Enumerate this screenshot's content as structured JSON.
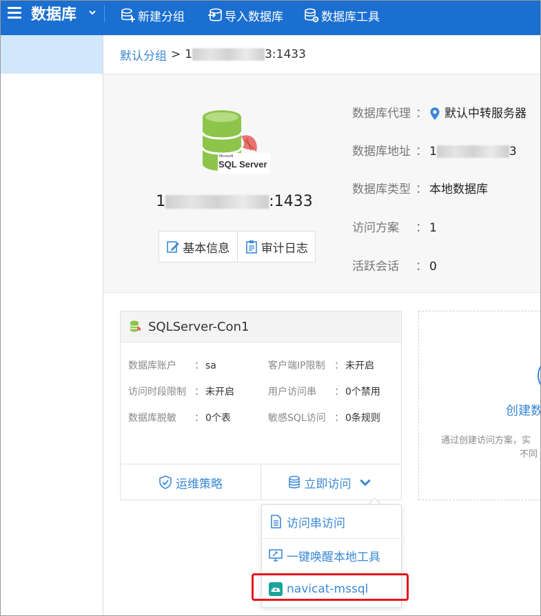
{
  "header": {
    "app_title": "数据库",
    "buttons": {
      "new_group": "新建分组",
      "import_db": "导入数据库",
      "db_tools": "数据库工具"
    }
  },
  "breadcrumb": {
    "group": "默认分组",
    "separator": ">",
    "current_prefix": "1",
    "current_suffix": "3:1433"
  },
  "database": {
    "logo_vendor": "Microsoft",
    "logo_product": "SQL Server",
    "host_prefix": "1",
    "host_suffix": ":1433",
    "tabs": {
      "basic_info": "基本信息",
      "audit_log": "审计日志"
    },
    "properties": [
      {
        "label": "数据库代理",
        "colon": "：",
        "value": "默认中转服务器"
      },
      {
        "label": "数据库地址",
        "colon": "：",
        "value": "1",
        "value_suffix": "3"
      },
      {
        "label": "数据库类型",
        "colon": "：",
        "value": "本地数据库"
      },
      {
        "label": "访问方案",
        "colon": "：",
        "value": "1"
      },
      {
        "label": "活跃会话",
        "colon": "：",
        "value": "0"
      }
    ]
  },
  "connection_card": {
    "name": "SQLServer-Con1",
    "fields": [
      {
        "key": "数据库账户",
        "colon": "：",
        "value": "sa"
      },
      {
        "key": "客户端IP限制",
        "colon": "：",
        "value": "未开启"
      },
      {
        "key": "访问时段限制",
        "colon": "：",
        "value": "未开启"
      },
      {
        "key": "用户访问串",
        "colon": "：",
        "value": "0个禁用"
      },
      {
        "key": "数据库脱敏",
        "colon": "：",
        "value": "0个表"
      },
      {
        "key": "敏感SQL访问",
        "colon": "：",
        "value": "0条规则"
      }
    ],
    "footer": {
      "ops_policy": "运维策略",
      "access_now": "立即访问"
    }
  },
  "create_card": {
    "title": "创建数",
    "desc_line1": "通过创建访问方案，实",
    "desc_line2": "不同"
  },
  "access_menu": {
    "items": [
      {
        "label": "访问串访问"
      },
      {
        "label": "一键唤醒本地工具"
      },
      {
        "label": "navicat-mssql"
      }
    ]
  },
  "colors": {
    "primary": "#1a6fd0",
    "accent": "#3a88d6",
    "highlight": "#e8141b",
    "nav_active": "#d1e7fb",
    "db_green": "#8dc54b"
  }
}
